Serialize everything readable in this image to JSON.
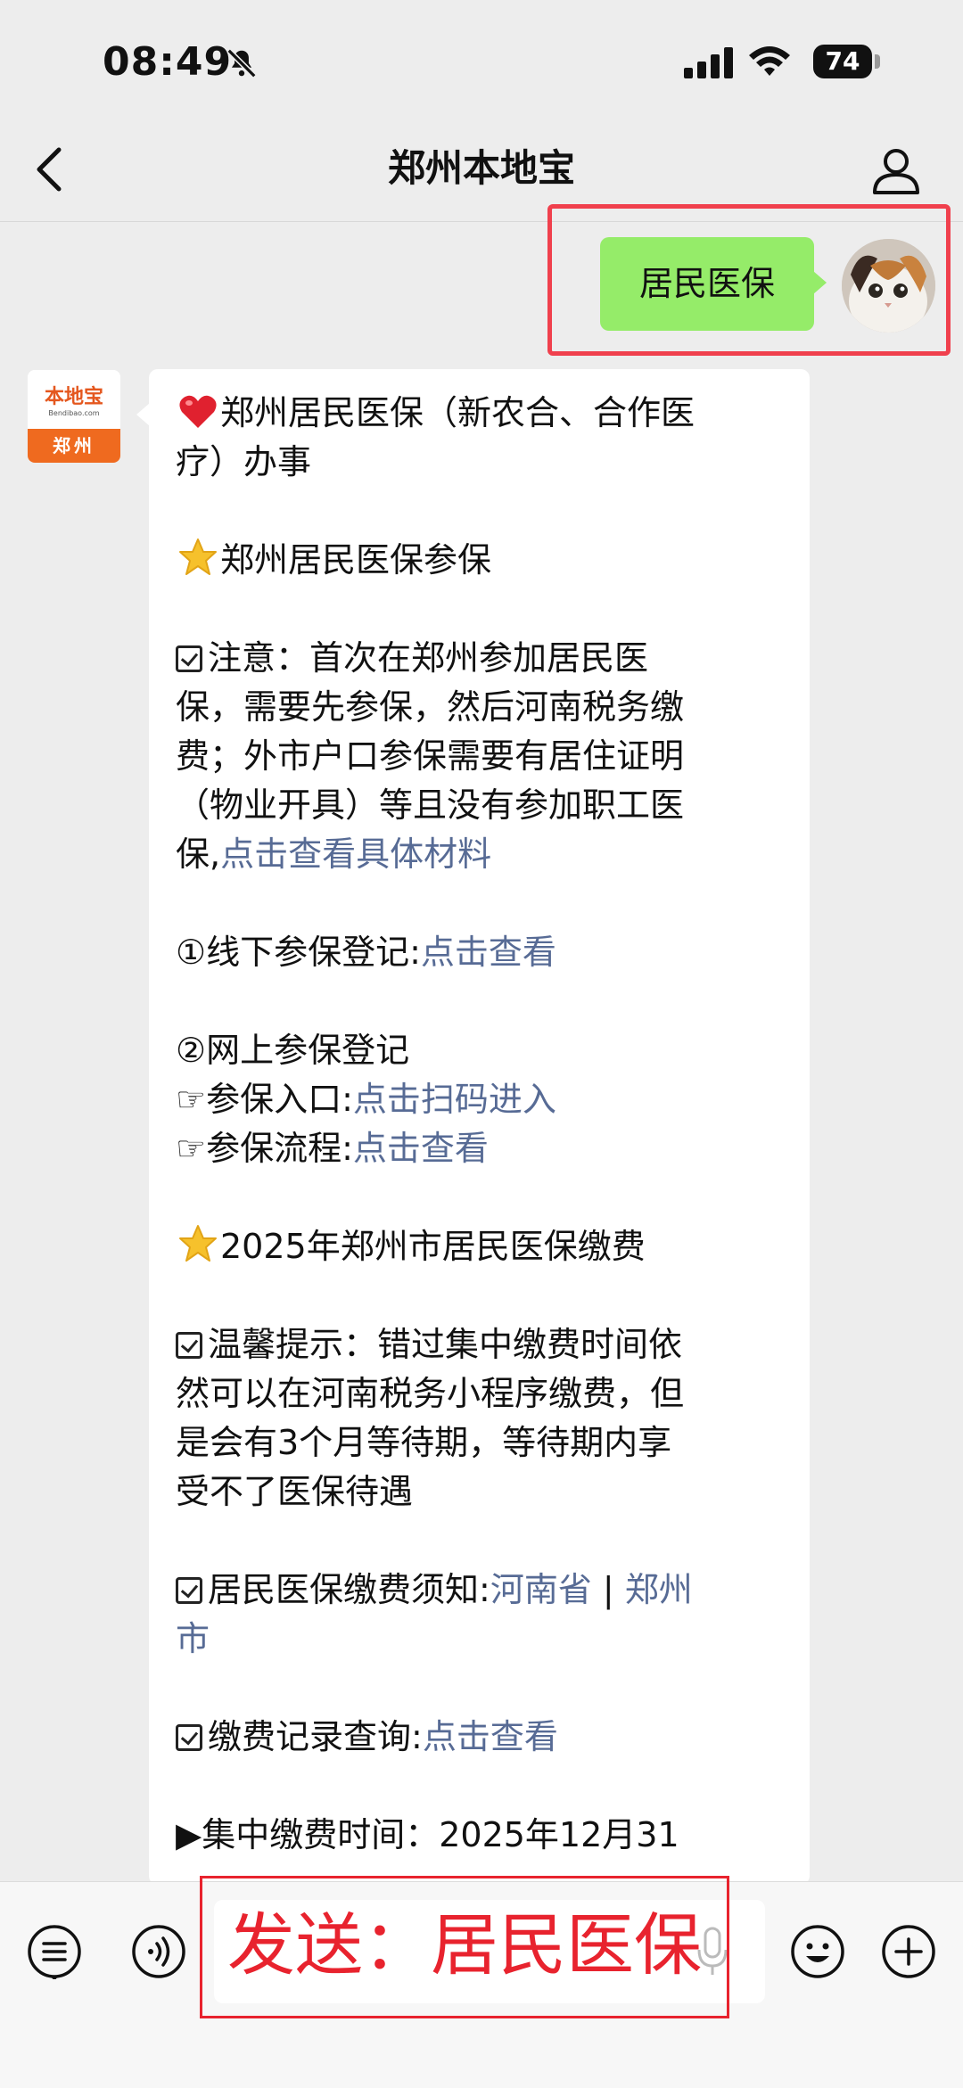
{
  "status_bar": {
    "time": "08:49",
    "battery": "74"
  },
  "nav": {
    "title": "郑州本地宝"
  },
  "sent_message": {
    "text": "居民医保"
  },
  "bot_avatar": {
    "brand": "本地宝",
    "sub": "Bendibao.com",
    "city": "郑州"
  },
  "message": {
    "l1": "郑州居民医保（新农合、合作医",
    "l2": "疗）办事",
    "section1": "郑州居民医保参保",
    "n1_1": "注意：首次在郑州参加居民医",
    "n1_2": "保，需要先参保，然后河南税务缴",
    "n1_3": "费；外市户口参保需要有居住证明",
    "n1_4": "（物业开具）等且没有参加职工医",
    "n1_5": "保,",
    "n1_link": "点击查看具体材料",
    "o1": "①线下参保登记:",
    "o1_link": "点击查看",
    "o2": "②网上参保登记",
    "o2_a": "☞参保入口:",
    "o2_a_link": "点击扫码进入",
    "o2_b": "☞参保流程:",
    "o2_b_link": "点击查看",
    "section2": "2025年郑州市居民医保缴费",
    "t1": "温馨提示：错过集中缴费时间依",
    "t2": "然可以在河南税务小程序缴费，但",
    "t3": "是会有3个月等待期，等待期内享",
    "t4": "受不了医保待遇",
    "k1": "居民医保缴费须知:",
    "k1_link1": "河南省",
    "k1_sep": " | ",
    "k1_link2": "郑州",
    "k1_link2b": "市",
    "k2": "缴费记录查询:",
    "k2_link": "点击查看",
    "k3": "▶集中缴费时间：2025年12月31"
  },
  "input_bar": {
    "send_hint": "发送：居民医保"
  },
  "icons": {
    "mute": "bell-slash-icon",
    "signal": "signal-icon",
    "wifi": "wifi-icon",
    "back": "chevron-left-icon",
    "user": "user-icon",
    "heart": "heart-icon",
    "star": "star-icon",
    "list": "list-icon",
    "voice": "voice-icon",
    "mic": "mic-icon",
    "emoji": "emoji-icon",
    "plus": "plus-icon"
  },
  "colors": {
    "sent_bubble": "#95ec69",
    "link": "#576b95",
    "highlight": "#e8232e"
  }
}
